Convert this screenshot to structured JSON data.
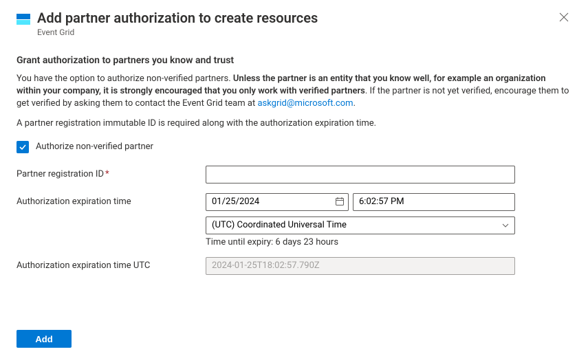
{
  "header": {
    "title": "Add partner authorization to create resources",
    "subtitle": "Event Grid"
  },
  "section_heading": "Grant authorization to partners you know and trust",
  "desc": {
    "pre": "You have the option to authorize non-verified partners. ",
    "bold": "Unless the partner is an entity that you know well, for example an organization within your company, it is strongly encouraged that you only work with verified partners",
    "post1": ". If the partner is not yet verified, encourage them to get verified by asking them to contact the Event Grid team at ",
    "email": "askgrid@microsoft.com",
    "post2": "."
  },
  "desc2": "A partner registration immutable ID is required along with the authorization expiration time.",
  "checkbox_label": "Authorize non-verified partner",
  "fields": {
    "registration_label": "Partner registration ID",
    "registration_value": "",
    "expiration_label": "Authorization expiration time",
    "date_value": "01/25/2024",
    "time_value": "6:02:57 PM",
    "timezone_value": "(UTC) Coordinated Universal Time",
    "expiry_hint": "Time until expiry: 6 days 23 hours",
    "utc_label": "Authorization expiration time UTC",
    "utc_value": "2024-01-25T18:02:57.790Z"
  },
  "footer": {
    "add_label": "Add"
  }
}
